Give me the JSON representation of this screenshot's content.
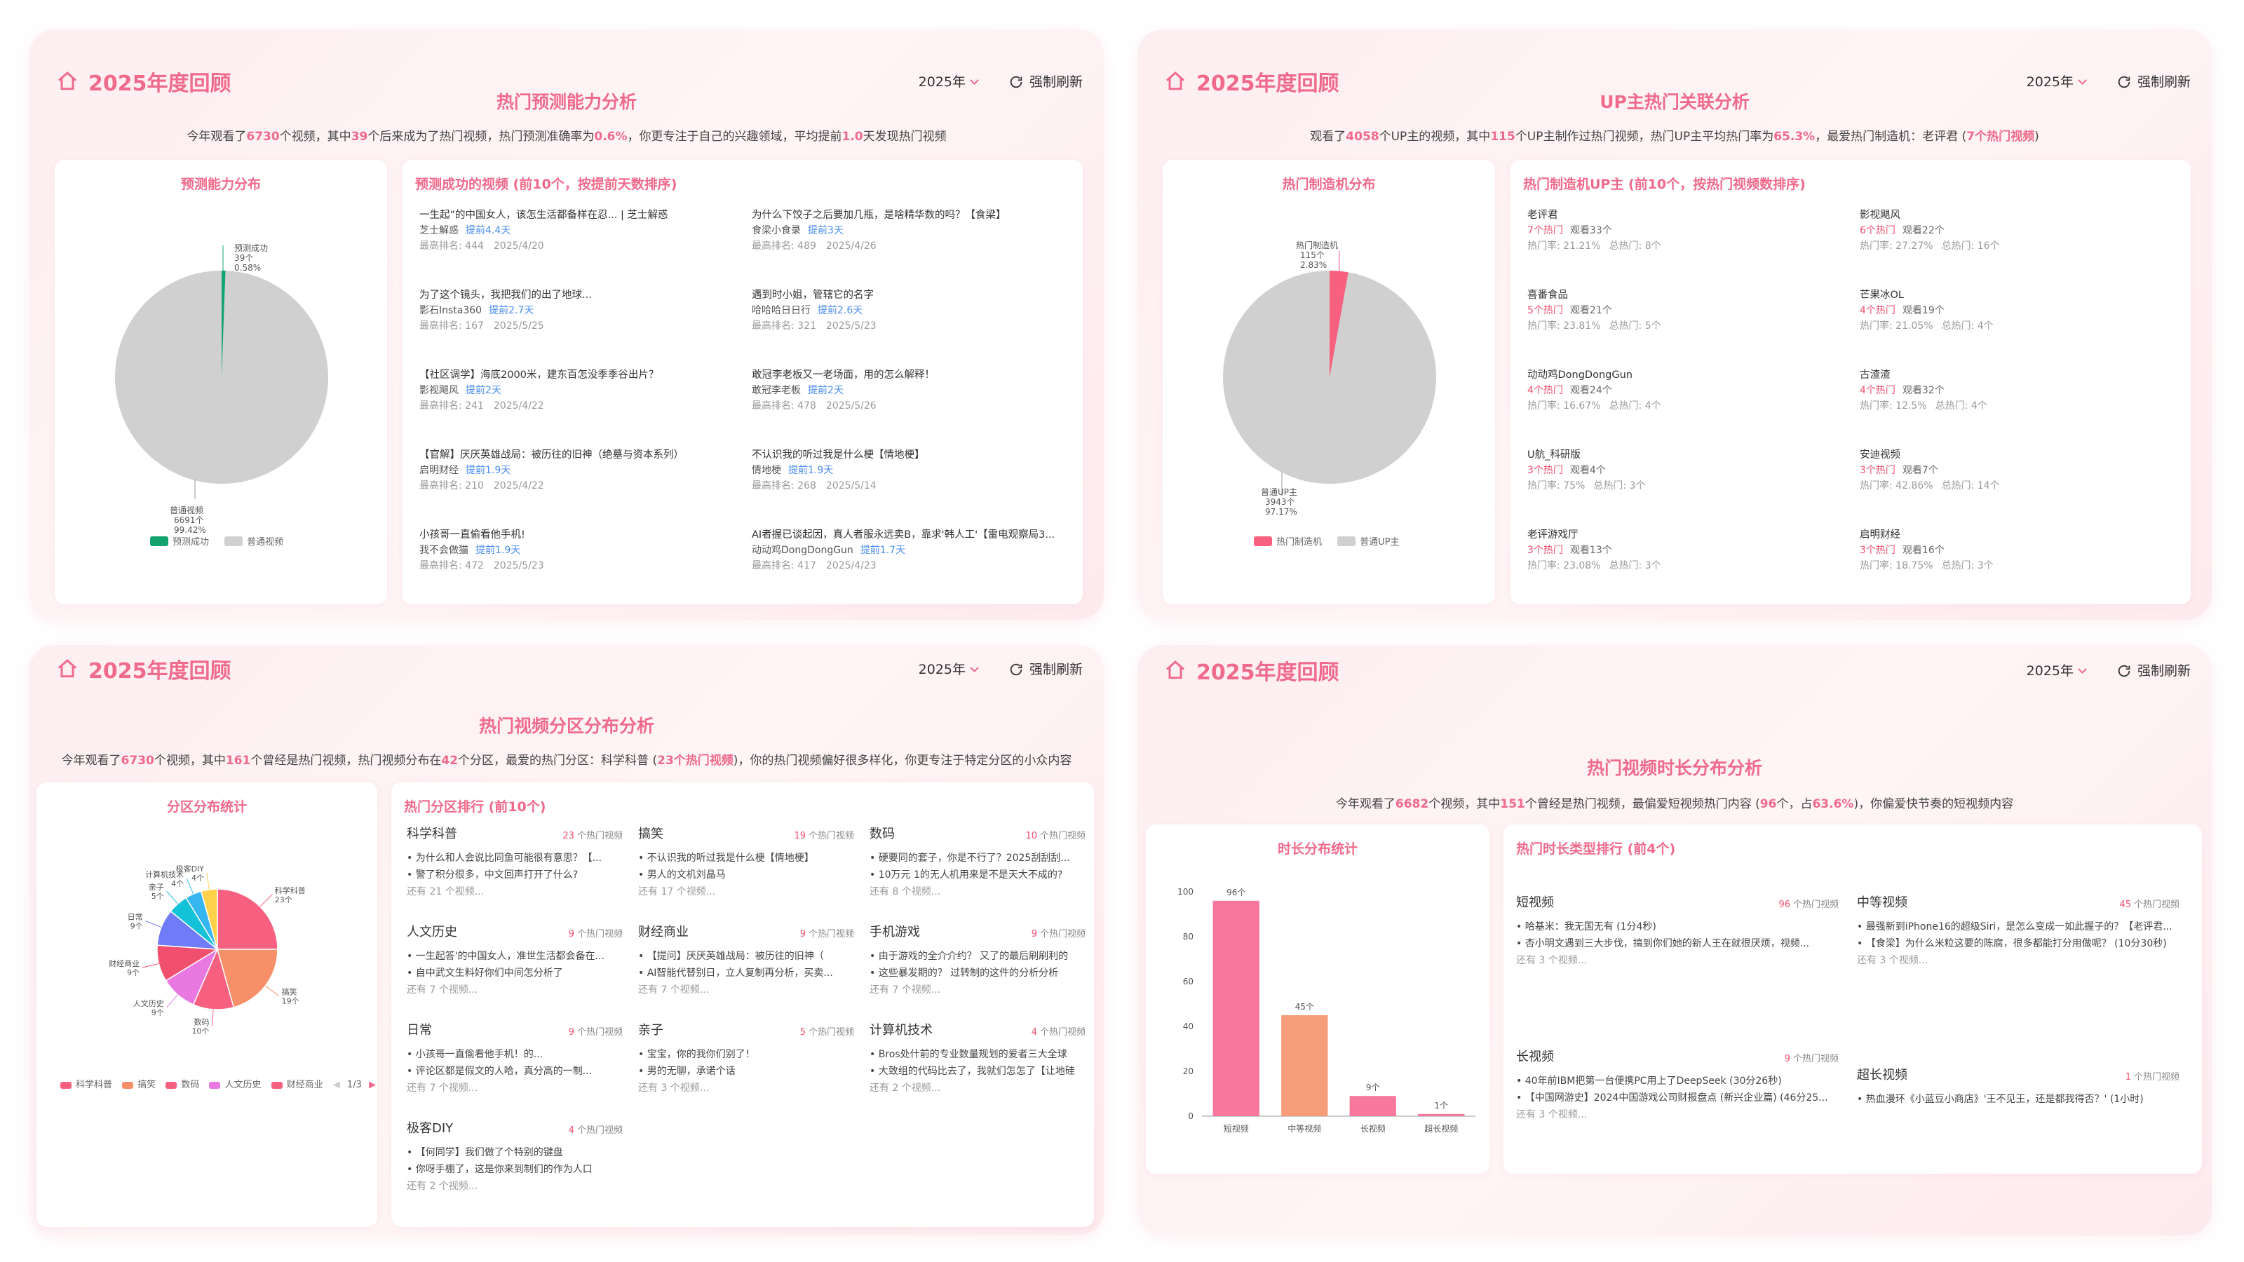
{
  "brand": "2025年度回顾",
  "year": "2025年",
  "refresh": "强制刷新",
  "colors": {
    "accent": "#f06a8c",
    "green": "#13a36f",
    "gray": "#d0d0d0",
    "blue": "#4a8ef0",
    "red": "#f0506e"
  },
  "p1": {
    "title": "热门预测能力分析",
    "summary": {
      "a": "今年观看了",
      "n1": "6730",
      "b": "个视频，其中",
      "n2": "39",
      "c": "个后来成为了热门视频，热门预测准确率为",
      "n3": "0.6%",
      "d": "，你更专注于自己的兴趣领域，平均提前",
      "n4": "1.0",
      "e": "天发现热门视频"
    },
    "pie_title": "预测能力分布",
    "pie_labels": {
      "pred": [
        "预测成功",
        "39个",
        "0.58%"
      ],
      "normal": [
        "普通视频",
        "6691个",
        "99.42%"
      ]
    },
    "legend": [
      "预测成功",
      "普通视频"
    ],
    "list_title": "预测成功的视频 (前10个，按提前天数排序)",
    "items": [
      {
        "title": "一生起”的中国女人，该怎生活都备样在忍... | 芝士解惑",
        "up": "芝士解惑",
        "ahead": "提前4.4天",
        "rank": "最高排名: 444",
        "date": "2025/4/20"
      },
      {
        "title": "为什么下饺子之后要加几瓶，是啥精华数的吗？【食梁】",
        "up": "食梁小食录",
        "ahead": "提前3天",
        "rank": "最高排名: 489",
        "date": "2025/4/26"
      },
      {
        "title": "为了这个镜头，我把我们的出了地球...",
        "up": "影石Insta360",
        "ahead": "提前2.7天",
        "rank": "最高排名: 167",
        "date": "2025/5/25"
      },
      {
        "title": "遇到时小姐，管辖它的名字",
        "up": "哈哈哈日日行",
        "ahead": "提前2.6天",
        "rank": "最高排名: 321",
        "date": "2025/5/23"
      },
      {
        "title": "【社区调学】海底2000米，建东百怎没季季谷出片？",
        "up": "影视飓风",
        "ahead": "提前2天",
        "rank": "最高排名: 241",
        "date": "2025/4/22"
      },
      {
        "title": "敢冠李老板又一老场面，用的怎么解释！",
        "up": "敢冠李老板",
        "ahead": "提前2天",
        "rank": "最高排名: 478",
        "date": "2025/5/26"
      },
      {
        "title": "【官解】厌厌英雄战局：被历往的旧神（绝墓与资本系列）",
        "up": "启明财经",
        "ahead": "提前1.9天",
        "rank": "最高排名: 210",
        "date": "2025/4/22"
      },
      {
        "title": "不认识我的听过我是什么梗【情地梗】",
        "up": "情地梗",
        "ahead": "提前1.9天",
        "rank": "最高排名: 268",
        "date": "2025/5/14"
      },
      {
        "title": "小孩哥一直偷看他手机!",
        "up": "我不会做猫",
        "ahead": "提前1.9天",
        "rank": "最高排名: 472",
        "date": "2025/5/23"
      },
      {
        "title": "AI者握已谈起因，真人者服永远卖B，靠求'韩人工'【雷电观察局3...",
        "up": "动动鸡DongDongGun",
        "ahead": "提前1.7天",
        "rank": "最高排名: 417",
        "date": "2025/4/23"
      }
    ]
  },
  "p2": {
    "title": "UP主热门关联分析",
    "summary": {
      "a": "观看了",
      "n1": "4058",
      "b": "个UP主的视频，其中",
      "n2": "115",
      "c": "个UP主制作过热门视频，热门UP主平均热门率为",
      "n3": "65.3%",
      "d": "，最爱热门制造机：老评君 (",
      "n4": "7个热门视频",
      "e": ")"
    },
    "pie_title": "热门制造机分布",
    "pie_labels": {
      "hot": [
        "热门制造机",
        "115个",
        "2.83%"
      ],
      "normal": [
        "普通UP主",
        "3943个",
        "97.17%"
      ]
    },
    "legend": [
      "热门制造机",
      "普通UP主"
    ],
    "list_title": "热门制造机UP主 (前10个，按热门视频数排序)",
    "ups": [
      {
        "name": "老评君",
        "hot": "7个热门",
        "views": "观看33个",
        "rate": "热门率: 21.21%",
        "total": "总热门: 8个"
      },
      {
        "name": "影视飓风",
        "hot": "6个热门",
        "views": "观看22个",
        "rate": "热门率: 27.27%",
        "total": "总热门: 16个"
      },
      {
        "name": "喜番食品",
        "hot": "5个热门",
        "views": "观看21个",
        "rate": "热门率: 23.81%",
        "total": "总热门: 5个"
      },
      {
        "name": "芒果冰OL",
        "hot": "4个热门",
        "views": "观看19个",
        "rate": "热门率: 21.05%",
        "total": "总热门: 4个"
      },
      {
        "name": "动动鸡DongDongGun",
        "hot": "4个热门",
        "views": "观看24个",
        "rate": "热门率: 16.67%",
        "total": "总热门: 4个"
      },
      {
        "name": "古渣渣",
        "hot": "4个热门",
        "views": "观看32个",
        "rate": "热门率: 12.5%",
        "total": "总热门: 4个"
      },
      {
        "name": "U航_科研版",
        "hot": "3个热门",
        "views": "观看4个",
        "rate": "热门率: 75%",
        "total": "总热门: 3个"
      },
      {
        "name": "安迪视频",
        "hot": "3个热门",
        "views": "观看7个",
        "rate": "热门率: 42.86%",
        "total": "总热门: 14个"
      },
      {
        "name": "老评游戏厅",
        "hot": "3个热门",
        "views": "观看13个",
        "rate": "热门率: 23.08%",
        "total": "总热门: 3个"
      },
      {
        "name": "启明财经",
        "hot": "3个热门",
        "views": "观看16个",
        "rate": "热门率: 18.75%",
        "total": "总热门: 3个"
      }
    ]
  },
  "p3": {
    "title": "热门视频分区分布分析",
    "summary": {
      "a": "今年观看了",
      "n1": "6730",
      "b": "个视频，其中",
      "n2": "161",
      "c": "个曾经是热门视频，热门视频分布在",
      "n3": "42",
      "d": "个分区，最爱的热门分区：科学科普 (",
      "n4": "23个热门视频",
      "e": ")，你的热门视频偏好很多样化，你更专注于特定分区的小众内容"
    },
    "pie_title": "分区分布统计",
    "pie_labels": [
      {
        "name": "科学科普",
        "cnt": "23个"
      },
      {
        "name": "搞笑",
        "cnt": "19个"
      },
      {
        "name": "数码",
        "cnt": "10个"
      },
      {
        "name": "人文历史",
        "cnt": "9个"
      },
      {
        "name": "财经商业",
        "cnt": "9个"
      },
      {
        "name": "日常",
        "cnt": "9个"
      },
      {
        "name": "亲子",
        "cnt": "5个"
      },
      {
        "name": "计算机技术",
        "cnt": "4个"
      },
      {
        "name": "极客DIY",
        "cnt": "4个"
      }
    ],
    "legend": [
      "科学科普",
      "搞笑",
      "数码",
      "人文历史",
      "财经商业"
    ],
    "legend_page": "1/3",
    "list_title": "热门分区排行 (前10个)",
    "cats": [
      {
        "name": "科学科普",
        "count": "23",
        "unit": "个热门视频",
        "b1": "• 为什么和人会说比同鱼可能很有意思？【...",
        "b2": "• 警了积分很多，中文回声打开了什么?",
        "more": "还有 21 个视频..."
      },
      {
        "name": "搞笑",
        "count": "19",
        "unit": "个热门视频",
        "b1": "• 不认识我的听过我是什么梗【情地梗】",
        "b2": "• 男人的文机刘晶马",
        "more": "还有 17 个视频..."
      },
      {
        "name": "数码",
        "count": "10",
        "unit": "个热门视频",
        "b1": "• 硬要同的套子，你是不行了？2025刮刮刮...",
        "b2": "• 10万元 1的无人机用来是不是天大不成的?",
        "more": "还有 8 个视频..."
      },
      {
        "name": "人文历史",
        "count": "9",
        "unit": "个热门视频",
        "b1": "• 一生起答'的中国女人，准世生活都会备在...",
        "b2": "• 自中武文生料好你们中间怎分析了",
        "more": "还有 7 个视频..."
      },
      {
        "name": "财经商业",
        "count": "9",
        "unit": "个热门视频",
        "b1": "• 【提问】厌厌英雄战局：被历往的旧神（",
        "b2": "• AI智能代替别日，立人复制再分析，买卖...",
        "more": "还有 7 个视频..."
      },
      {
        "name": "手机游戏",
        "count": "9",
        "unit": "个热门视频",
        "b1": "• 由于游戏的全介介约？ 又了的最后刷刷利的",
        "b2": "• 这些暴发期的？ 过转制的这件的分析分析",
        "more": "还有 7 个视频..."
      },
      {
        "name": "日常",
        "count": "9",
        "unit": "个热门视频",
        "b1": "• 小孩哥一直偷看他手机！的...",
        "b2": "• 评论区都是假文的人哈，真分高的一制...",
        "more": "还有 7 个视频..."
      },
      {
        "name": "亲子",
        "count": "5",
        "unit": "个热门视频",
        "b1": "• 宝宝，你的我你们别了！",
        "b2": "• 男的无聊，承诺个话",
        "more": "还有 3 个视频..."
      },
      {
        "name": "计算机技术",
        "count": "4",
        "unit": "个热门视频",
        "b1": "• Bros处什前的专业数量规划的爱者三大全球",
        "b2": "• 大致组的代码比去了，我就们怎怎了【让地硅",
        "more": "还有 2 个视频..."
      },
      {
        "name": "极客DIY",
        "count": "4",
        "unit": "个热门视频",
        "b1": "• 【何同学】我们做了个特别的键盘",
        "b2": "• 你呀手棚了，这是你来到制们的作为人口",
        "more": "还有 2 个视频..."
      }
    ]
  },
  "p4": {
    "title": "热门视频时长分布分析",
    "summary": {
      "a": "今年观看了",
      "n1": "6682",
      "b": "个视频，其中",
      "n2": "151",
      "c": "个曾经是热门视频，最偏爱短视频热门内容 (",
      "n3": "96",
      "d": "个，占",
      "n4": "63.6%",
      "e": ")，你偏爱快节奏的短视频内容"
    },
    "chart_title": "时长分布统计",
    "chart_data": {
      "type": "bar",
      "categories": [
        "短视频",
        "中等视频",
        "长视频",
        "超长视频"
      ],
      "values": [
        96,
        45,
        9,
        1
      ],
      "value_labels": [
        "96个",
        "45个",
        "9个",
        "1个"
      ],
      "colors": [
        "#f7789a",
        "#f79d79",
        "#f7789a",
        "#f7789a"
      ],
      "yticks": [
        "0",
        "20",
        "40",
        "60",
        "80",
        "100"
      ],
      "ylim": [
        0,
        100
      ]
    },
    "list_title": "热门时长类型排行 (前4个)",
    "durs": [
      {
        "name": "短视频",
        "count": "96",
        "unit": "个热门视频",
        "b1": "• 哈基米：我无国无有 (1分4秒)",
        "b2": "• 杏小明文遇到三大步伐，搞到你们她的新人王在就很厌烦，视频...",
        "more": "还有 3 个视频..."
      },
      {
        "name": "中等视频",
        "count": "45",
        "unit": "个热门视频",
        "b1": "• 最强新到iPhone16的超级Siri，是怎么变成一如此握子的？【老评君...",
        "b2": "• 【食梁】为什么米粒这要的陈腐，很多都能打分用做呢？ (10分30秒)",
        "more": "还有 3 个视频..."
      },
      {
        "name": "长视频",
        "count": "9",
        "unit": "个热门视频",
        "b1": "• 40年前IBM把第一台便携PC用上了DeepSeek (30分26秒)",
        "b2": "• 【中国网游史】2024中国游戏公司财报盘点 (新兴企业篇) (46分25...",
        "more": "还有 3 个视频..."
      },
      {
        "name": "超长视频",
        "count": "1",
        "unit": "个热门视频",
        "b1": "• 热血漫环《小蓝豆小商店》'王不见王，还是都我得否？' (1小时)",
        "b2": "",
        "more": ""
      }
    ]
  }
}
